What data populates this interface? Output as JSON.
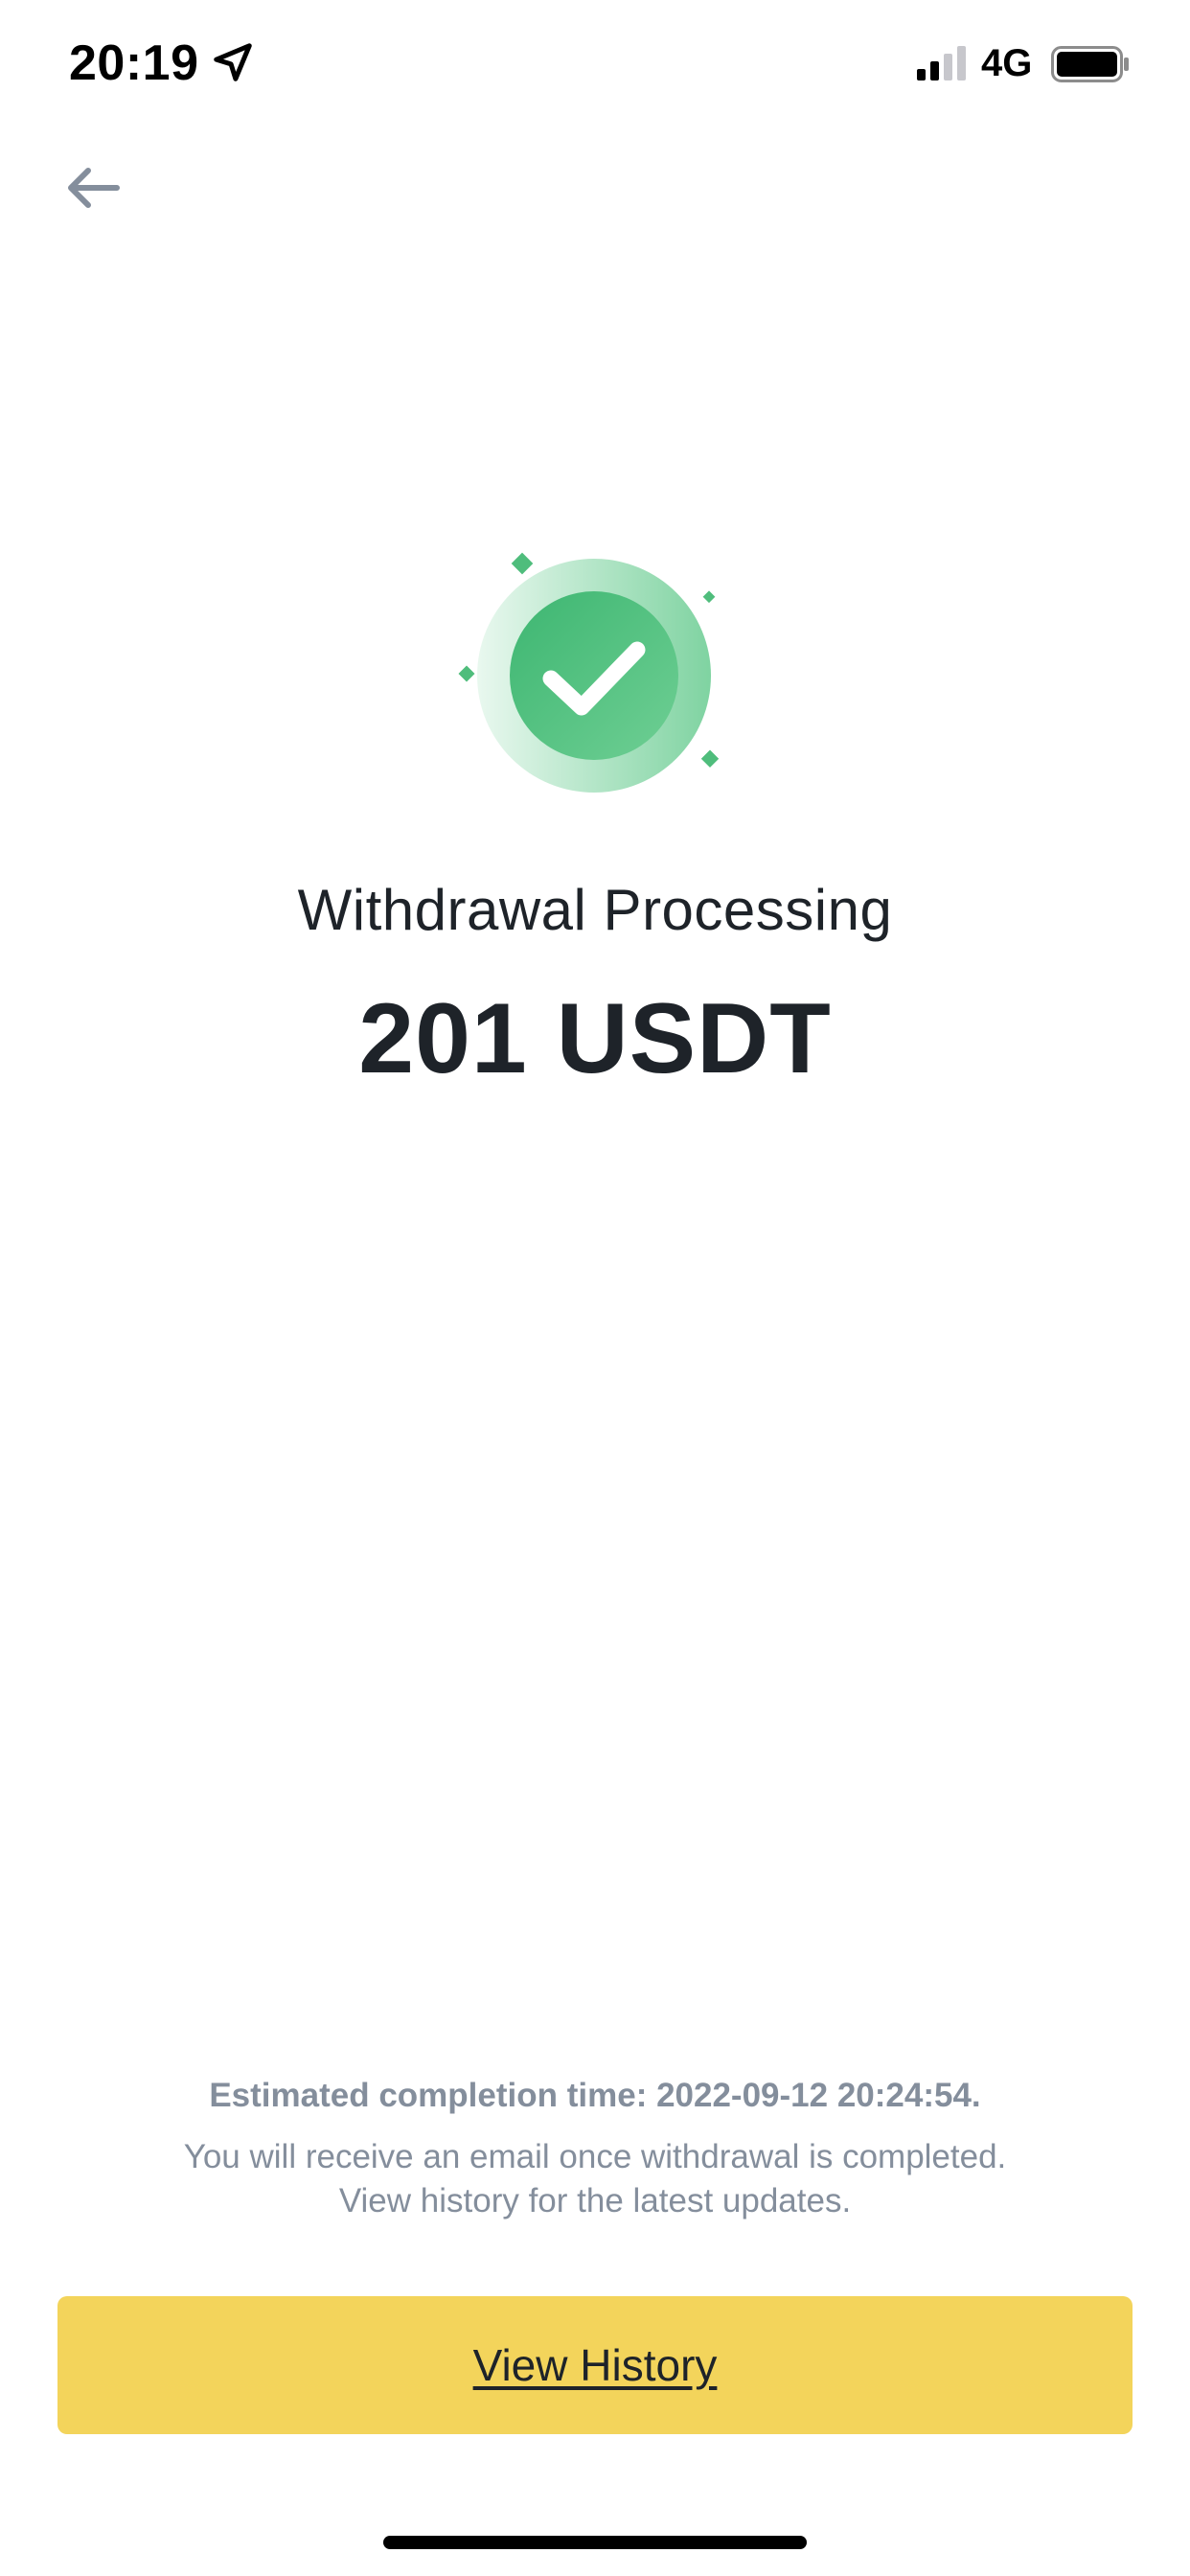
{
  "status_bar": {
    "time": "20:19",
    "network": "4G",
    "icons": [
      "location-arrow-icon",
      "signal-icon",
      "battery-icon"
    ]
  },
  "navigation": {
    "back_icon": "arrow-left-icon"
  },
  "result": {
    "status_icon": "check-circle-icon",
    "title": "Withdrawal Processing",
    "amount": "201 USDT"
  },
  "footer": {
    "estimated": "Estimated completion time: 2022-09-12 20:24:54.",
    "note_line_1": "You will receive an email once withdrawal is completed.",
    "note_line_2": "View history for the latest updates.",
    "button_label": "View History"
  },
  "colors": {
    "accent_yellow": "#f3d45b",
    "success_green": "#58c182",
    "text_primary": "#1e2329",
    "text_secondary": "#848e9c"
  }
}
